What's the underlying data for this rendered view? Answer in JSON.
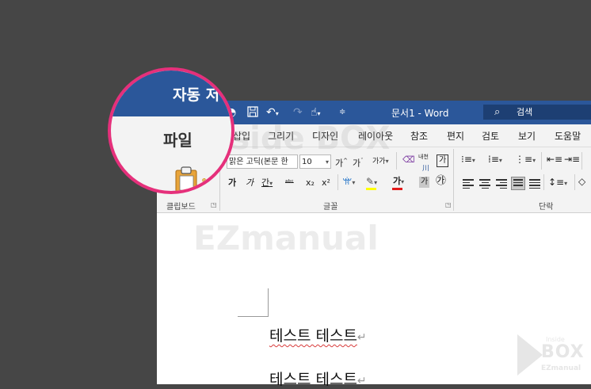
{
  "title_bar": {
    "doc_title": "문서1 - Word",
    "search_label": "검색",
    "icons": [
      "autosave-icon",
      "save-icon",
      "undo-icon",
      "redo-icon",
      "touch-mode-icon",
      "customize-qat-icon"
    ]
  },
  "tabs": {
    "file": "파일",
    "insert": "삽입",
    "draw": "그리기",
    "design": "디자인",
    "layout": "레이아웃",
    "references": "참조",
    "mailings": "편지",
    "review": "검토",
    "view": "보기",
    "help": "도움말"
  },
  "ribbon": {
    "clipboard_label": "클립보드",
    "font_label": "글꼴",
    "paragraph_label": "단락",
    "font_name": "맑은 고딕(본문 한",
    "font_size": "10",
    "grow_font": "가",
    "shrink_font": "가",
    "case_button": "가가",
    "phonetic_label": "내천",
    "phonetic_sub": "川",
    "char_border": "가",
    "bold": "가",
    "italic": "가",
    "underline": "간",
    "strikethrough": "ᵃᵇᶜ",
    "subscript": "x₂",
    "superscript": "x²",
    "highlight": "ab",
    "font_color": "가",
    "char_shading": "가",
    "enclosed_char": "㉮",
    "colors": {
      "highlight": "#ffff00",
      "font_color": "#e31b1b",
      "accent": "#2b579a",
      "magnifier_ring": "#e5307b"
    }
  },
  "document": {
    "line1": "테스트 테스트",
    "line2": "테스트 테스트",
    "para_mark": "↵"
  },
  "magnifier": {
    "title": "자동 저",
    "tab": "파일"
  },
  "watermark": {
    "line1": "Inside BOX",
    "line2": "EZmanual"
  },
  "logo": {
    "line1": "Inside",
    "line2": "BOX",
    "line3": "EZmanual"
  }
}
